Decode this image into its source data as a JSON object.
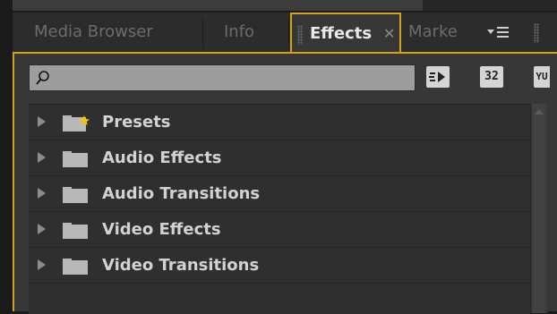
{
  "tabs": [
    {
      "label": "Media Browser"
    },
    {
      "label": "Info"
    },
    {
      "label": "Effects",
      "active": true
    },
    {
      "label": "Marke"
    }
  ],
  "search": {
    "placeholder": "",
    "value": ""
  },
  "toolbar": {
    "accelerated_icon": "accelerated-effects-icon",
    "bit32_label": "32",
    "yuv_label": "YU"
  },
  "tree": {
    "items": [
      {
        "label": "Presets",
        "icon": "presets-folder-icon"
      },
      {
        "label": "Audio Effects",
        "icon": "folder-icon"
      },
      {
        "label": "Audio Transitions",
        "icon": "folder-icon"
      },
      {
        "label": "Video Effects",
        "icon": "folder-icon"
      },
      {
        "label": "Video Transitions",
        "icon": "folder-icon"
      }
    ]
  },
  "colors": {
    "accent": "#d4a21a",
    "panel": "#373737",
    "tree": "#2f2f2f"
  }
}
